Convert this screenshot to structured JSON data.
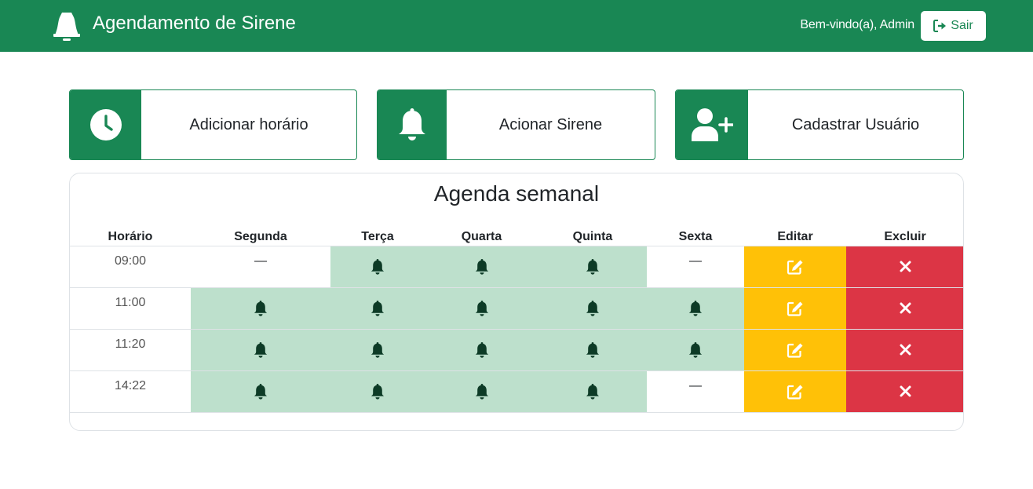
{
  "navbar": {
    "title": "Agendamento de Sirene",
    "brand_icon": "bell-icon",
    "welcome": "Bem-vindo(a), Admin",
    "logout_label": "Sair"
  },
  "actions": [
    {
      "label": "Adicionar horário",
      "icon": "clock-icon"
    },
    {
      "label": "Acionar Sirene",
      "icon": "bell-icon"
    },
    {
      "label": "Cadastrar Usuário",
      "icon": "user-plus-icon"
    }
  ],
  "schedule": {
    "title": "Agenda semanal",
    "headers": [
      "Horário",
      "Segunda",
      "Terça",
      "Quarta",
      "Quinta",
      "Sexta",
      "Editar",
      "Excluir"
    ],
    "empty_marker": "—",
    "rows": [
      {
        "time": "09:00",
        "days": [
          false,
          true,
          true,
          true,
          false
        ]
      },
      {
        "time": "11:00",
        "days": [
          true,
          true,
          true,
          true,
          true
        ]
      },
      {
        "time": "11:20",
        "days": [
          true,
          true,
          true,
          true,
          true
        ]
      },
      {
        "time": "14:22",
        "days": [
          true,
          true,
          true,
          true,
          false
        ]
      }
    ]
  },
  "colors": {
    "primary": "#198754",
    "active_cell": "#bde0cc",
    "edit": "#ffc107",
    "delete": "#dc3545",
    "bell_icon": "#0d3b26"
  }
}
